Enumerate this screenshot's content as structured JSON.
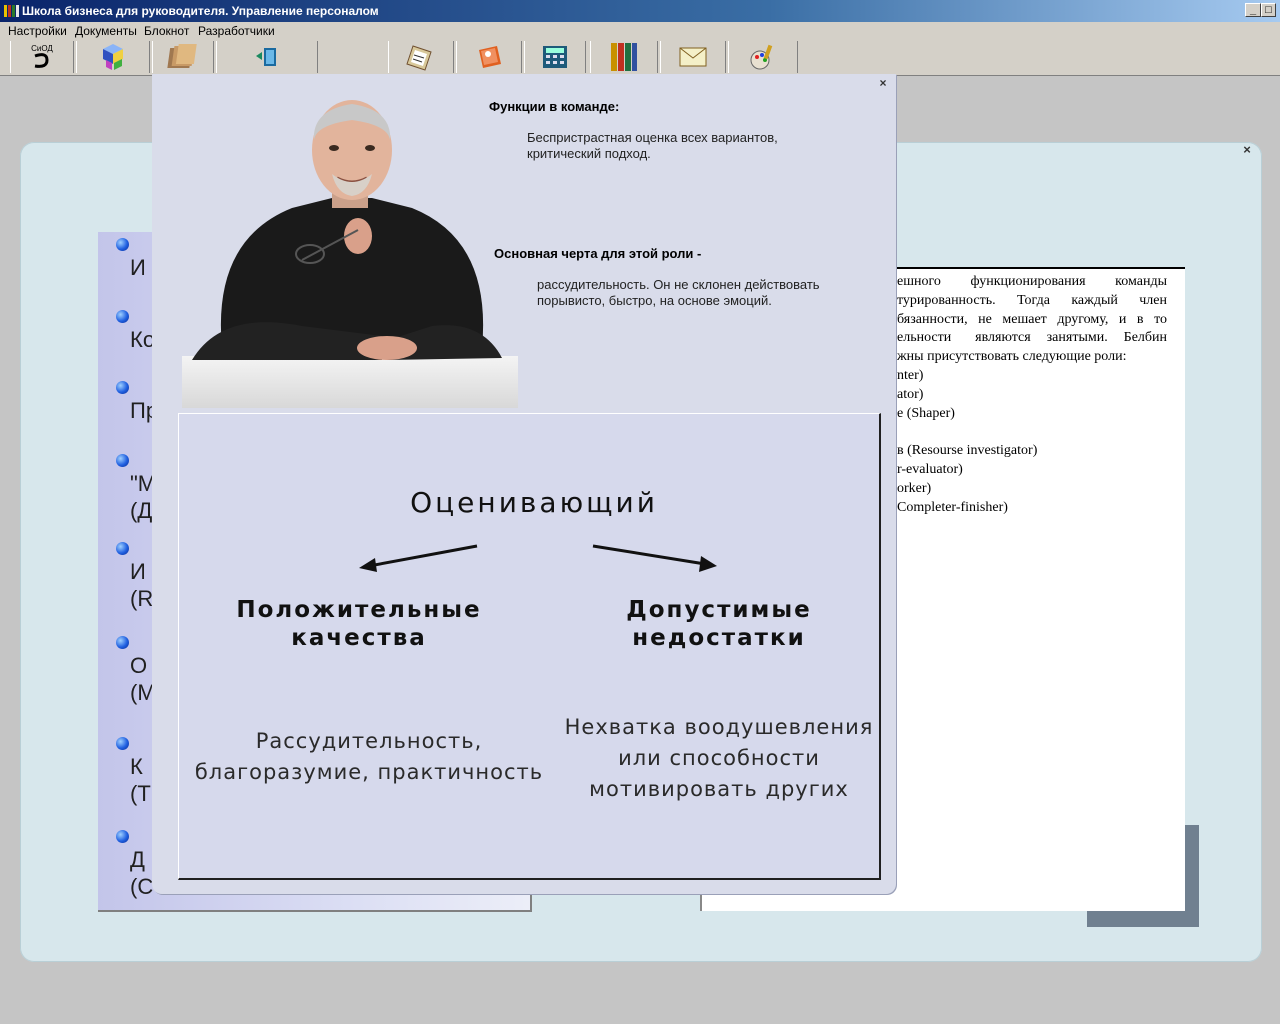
{
  "window": {
    "title": "Школа бизнеса для руководителя. Управление персоналом",
    "minimize": "_",
    "maximize": "□",
    "close": "×"
  },
  "menu": [
    "Настройки",
    "Документы",
    "Блокнот",
    "Разработчики"
  ],
  "toolbar": {
    "icons": [
      "logo-icon",
      "cubes-icon",
      "folders-icon",
      "exit-door-icon",
      "clipboard-icon",
      "address-book-icon",
      "calculator-icon",
      "books-icon",
      "envelope-icon",
      "palette-icon"
    ],
    "logo_text": "СиОД"
  },
  "left_list": {
    "items": [
      {
        "text": "И"
      },
      {
        "text": "Ко"
      },
      {
        "text": "Пр"
      },
      {
        "text": "\"М\n(Д"
      },
      {
        "text": "И\n(R"
      },
      {
        "text": "О\n(М"
      },
      {
        "text": "К\n(Т"
      },
      {
        "text": "Д\n(С"
      }
    ]
  },
  "right_panel": {
    "lines": [
      "ешного   функционирования   команды",
      "турированность.   Тогда   каждый   член",
      "бязанности, не мешает другому, и в то",
      "ельности   являются  занятыми.  Белбин",
      "жны присутствовать следующие роли:",
      "nter)",
      "ator)",
      "e (Shaper)",
      "",
      "в (Resourse investigator)",
      "r-evaluator)",
      "orker)",
      "Completer-finisher)"
    ]
  },
  "popup": {
    "close": "×",
    "functions_heading": "Функции в команде:",
    "functions_text": "Беспристрастная оценка всех вариантов,\nкритический подход.",
    "trait_heading": "Основная черта для этой роли -",
    "trait_text": "рассудительность. Он не склонен действовать\nпорывисто, быстро, на основе эмоций.",
    "role_title": "Оценивающий",
    "positive_title": "Положительные\nкачества",
    "negative_title": "Допустимые\nнедостатки",
    "positive_text": "Рассудительность,\nблагоразумие, практичность",
    "negative_text": "Нехватка воодушевления\nили способности\nмотивировать других"
  }
}
